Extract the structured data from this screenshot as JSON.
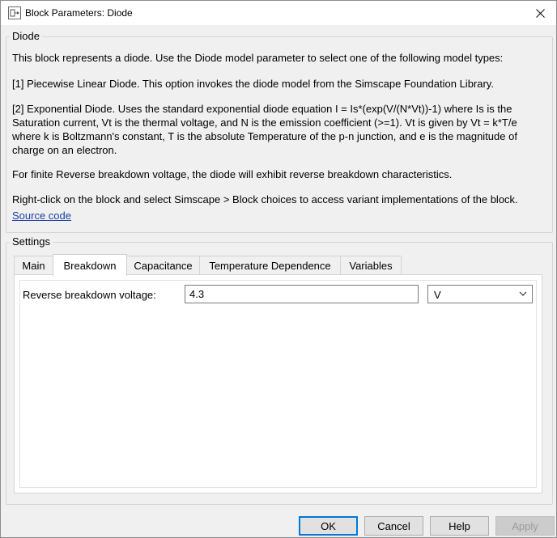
{
  "window": {
    "title": "Block Parameters: Diode"
  },
  "description_group": {
    "legend": "Diode",
    "paragraphs": [
      "This block represents a diode. Use the Diode model parameter to select one of the following model types:",
      "[1] Piecewise Linear Diode. This option invokes the diode model from the Simscape Foundation Library.",
      "[2] Exponential Diode. Uses the standard exponential diode equation I = Is*(exp(V/(N*Vt))-1) where Is is the Saturation current, Vt is the thermal voltage, and N is the emission coefficient (>=1). Vt is given by Vt = k*T/e where k is Boltzmann's constant, T is the absolute Temperature of the p-n junction, and e is the magnitude of charge on an electron.",
      "For finite Reverse breakdown voltage, the diode will exhibit reverse breakdown characteristics.",
      "Right-click on the block and select Simscape > Block choices to access variant implementations of the block."
    ],
    "link": "Source code"
  },
  "settings_group": {
    "legend": "Settings",
    "tabs": [
      {
        "label": "Main"
      },
      {
        "label": "Breakdown"
      },
      {
        "label": "Capacitance"
      },
      {
        "label": "Temperature Dependence"
      },
      {
        "label": "Variables"
      }
    ],
    "active_tab": "Breakdown",
    "parameter": {
      "label": "Reverse breakdown voltage:",
      "value": "4.3",
      "unit": "V"
    }
  },
  "buttons": {
    "ok": "OK",
    "cancel": "Cancel",
    "help": "Help",
    "apply": "Apply"
  },
  "colors": {
    "link": "#1a3ea6",
    "focus_border": "#0078d7"
  }
}
